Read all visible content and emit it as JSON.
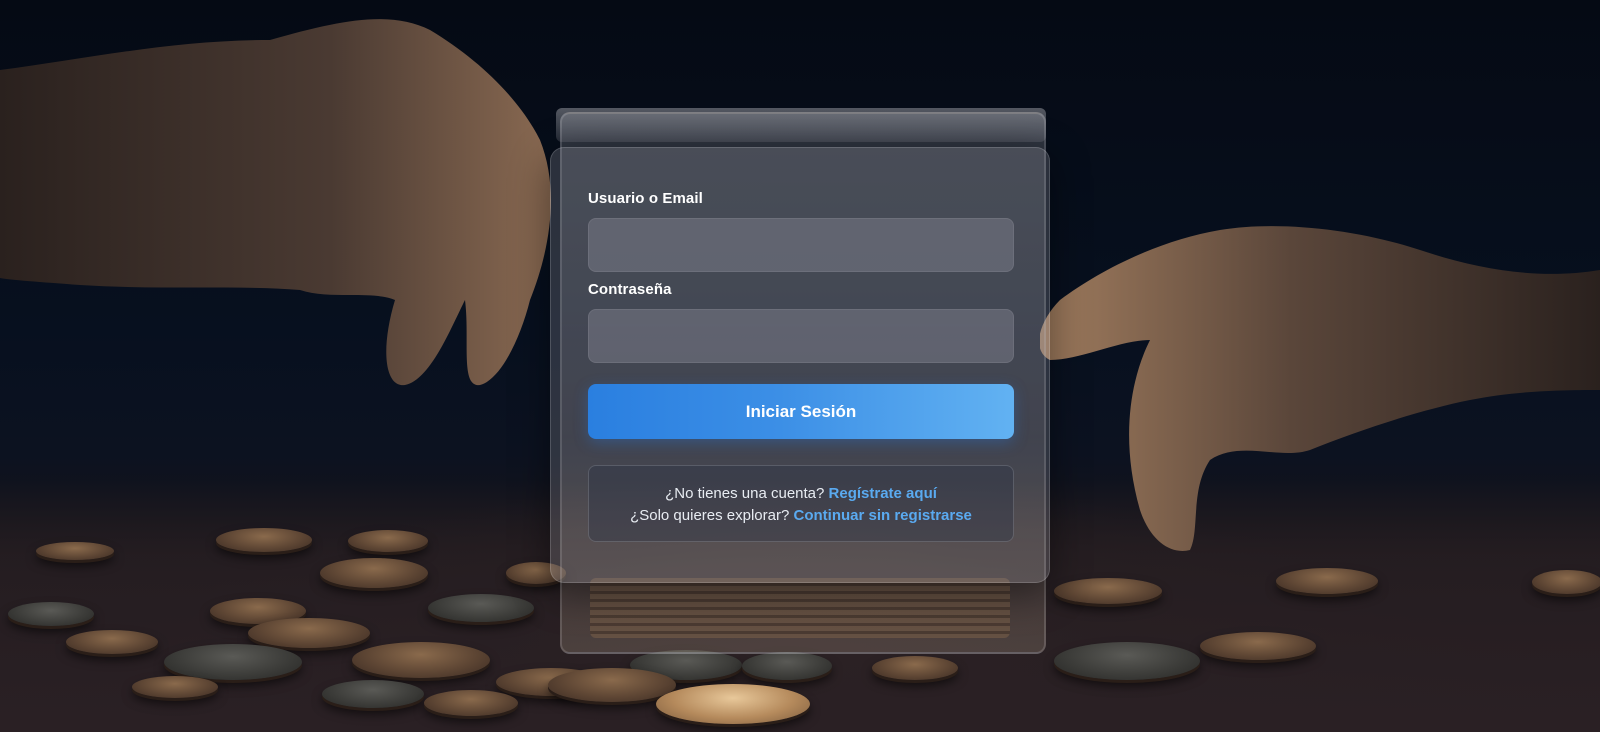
{
  "login": {
    "username_label": "Usuario o Email",
    "username_value": "",
    "password_label": "Contraseña",
    "password_value": "",
    "submit_label": "Iniciar Sesión"
  },
  "links": {
    "register_prompt": "¿No tienes una cuenta?",
    "register_link": "Regístrate aquí",
    "guest_prompt": "¿Solo quieres explorar?",
    "guest_link": "Continuar sin registrarse"
  },
  "colors": {
    "primary": "#2a7fe0",
    "link": "#5aaaf0"
  }
}
